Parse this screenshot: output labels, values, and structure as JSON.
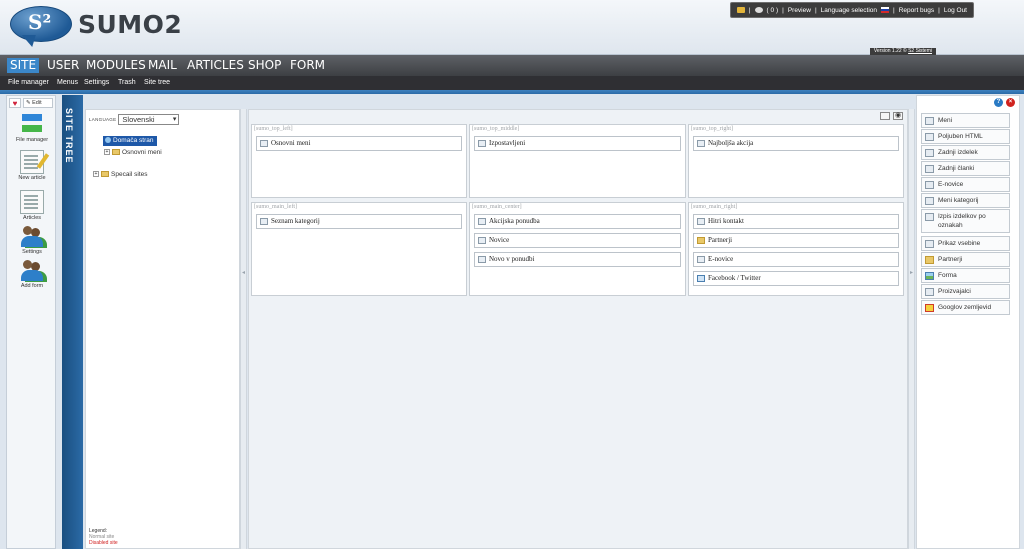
{
  "header": {
    "logo_mark": "S²",
    "logo_text": "SUMO2",
    "toplinks": {
      "count": "( 0 )",
      "preview": "Preview",
      "language_selection": "Language selection",
      "report_bugs": "Report bugs",
      "log_out": "Log Out",
      "separator": "|"
    },
    "version_label": "Version 1.22 ©",
    "version_link": "S2 Sistemi"
  },
  "mainnav": {
    "items": [
      "SITE",
      "USER",
      "MODULES",
      "MAIL",
      "ARTICLES",
      "SHOP",
      "FORM"
    ],
    "active": "SITE"
  },
  "subnav": {
    "items": [
      "File manager",
      "Menus",
      "Settings",
      "Trash",
      "Site tree"
    ]
  },
  "lefttools": {
    "edit_label": "Edit",
    "tools": [
      "File manager",
      "New article",
      "Articles",
      "Settings",
      "Add form"
    ]
  },
  "sitetree": {
    "tab_label": "SITE TREE",
    "language_label": "LANGUAGE",
    "language_value": "Slovenski",
    "nodes": [
      "Domača stran",
      "Osnovni meni",
      "Specail sites"
    ],
    "expander_plus": "+",
    "legend_title": "Legend:",
    "legend_normal": "Normal site",
    "legend_disabled": "Disabled site"
  },
  "canvas": {
    "regions": [
      {
        "label": "[sumo_top_left]",
        "modules": [
          "Osnovni meni"
        ]
      },
      {
        "label": "[sumo_top_middle]",
        "modules": [
          "Izpostavljeni"
        ]
      },
      {
        "label": "[sumo_top_right]",
        "modules": [
          "Najboljša akcija"
        ]
      },
      {
        "label": "[sumo_main_left]",
        "modules": [
          "Seznam kategorij"
        ]
      },
      {
        "label": "[sumo_main_center]",
        "modules": [
          "Akcijska ponudba",
          "Novice",
          "Novo v ponudbi"
        ]
      },
      {
        "label": "[sumo_main_right]",
        "modules": [
          "Hitri kontakt",
          "Partnerji",
          "E-novice",
          "Facebook / Twitter"
        ]
      }
    ]
  },
  "rightpanel": {
    "help": "?",
    "close": "×",
    "items": [
      "Meni",
      "Poljuben HTML",
      "Zadnji izdelek",
      "Zadnji članki",
      "E-novice",
      "Meni kategorij",
      "Izpis izdelkov po oznakah",
      "Prikaz vsebine",
      "Partnerji",
      "Forma",
      "Proizvajalci",
      "Googlov zemljevid"
    ]
  },
  "colors": {
    "accent": "#3b87c9",
    "nav_dark": "#3d3f43",
    "tab_blue": "#2b6aa6",
    "disabled_red": "#d02020"
  }
}
